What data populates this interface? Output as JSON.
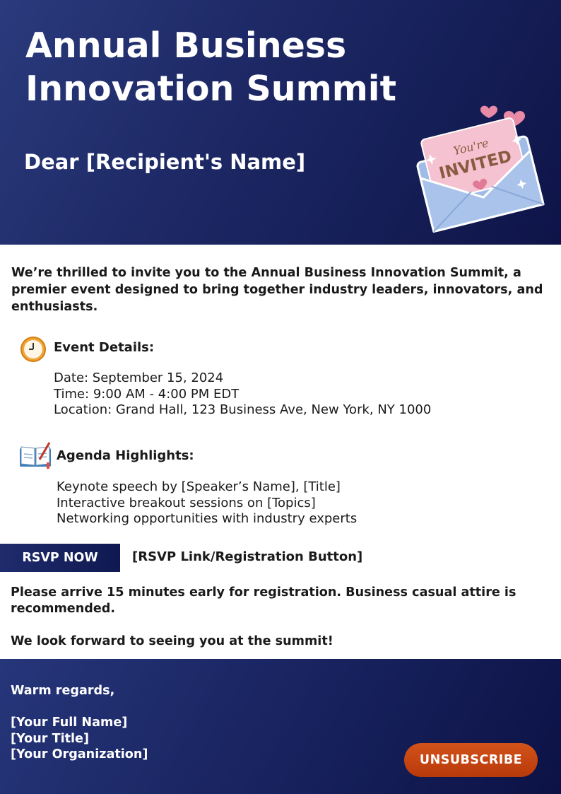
{
  "header": {
    "title": "Annual Business Innovation Summit",
    "greeting": "Dear [Recipient's Name]",
    "invite_badge_line1": "You're",
    "invite_badge_line2": "INVITED"
  },
  "intro": "We’re thrilled to invite you to the Annual Business Innovation Summit, a premier event designed to bring together industry leaders, innovators, and enthusiasts.",
  "event_details": {
    "heading": "Event Details:",
    "icon": "clock-icon",
    "lines": [
      "Date: September 15, 2024",
      "Time: 9:00 AM - 4:00 PM EDT",
      "Location: Grand Hall, 123 Business Ave, New York, NY 1000"
    ]
  },
  "agenda": {
    "heading": "Agenda Highlights:",
    "icon": "notebook-icon",
    "items": [
      "Keynote speech by [Speaker’s Name], [Title]",
      "Interactive breakout sessions on [Topics]",
      "Networking opportunities with industry experts"
    ]
  },
  "rsvp": {
    "button_label": "RSVP NOW",
    "link_text": "[RSVP Link/Registration Button]"
  },
  "note": "Please arrive 15 minutes early for registration. Business casual attire is recommended.",
  "closing_line": "We look forward to seeing you at the summit!",
  "footer": {
    "regards": "Warm regards,",
    "name": "[Your Full Name]",
    "title": "[Your Title]",
    "organization": "[Your Organization]",
    "unsubscribe_label": "UNSUBSCRIBE"
  },
  "colors": {
    "header_navy": "#1c2763",
    "unsubscribe_orange": "#c84a12"
  }
}
